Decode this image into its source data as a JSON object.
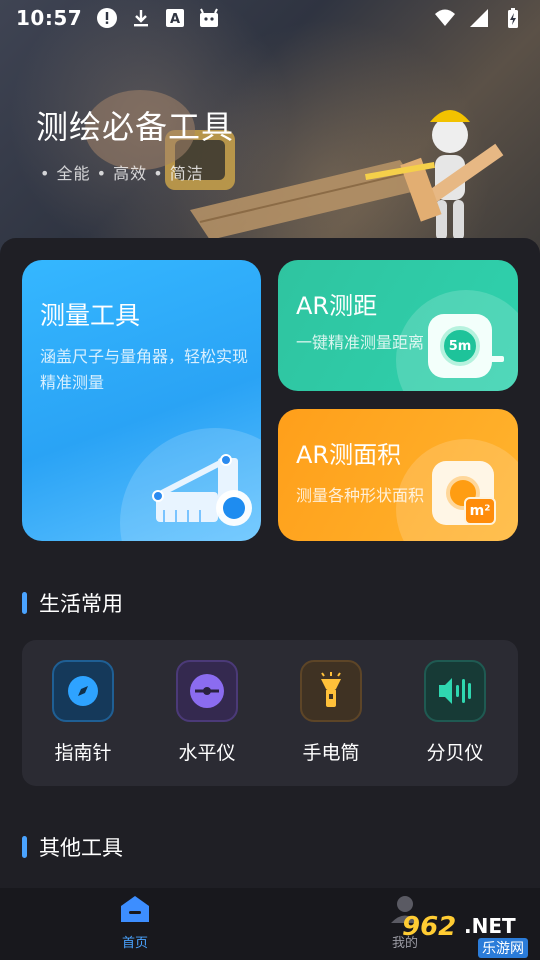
{
  "status_bar": {
    "time": "10:57"
  },
  "hero": {
    "title": "测绘必备工具",
    "subtitle": "• 全能  • 高效 •  简洁"
  },
  "cards": {
    "measure": {
      "title": "测量工具",
      "desc": "涵盖尺子与量角器，轻松实现精准测量"
    },
    "ar_distance": {
      "title": "AR测距",
      "desc": "一键精准测量距离",
      "badge": "5m"
    },
    "ar_area": {
      "title": "AR测面积",
      "desc": "测量各种形状面积",
      "badge": "m²"
    }
  },
  "sections": {
    "daily": "生活常用",
    "other": "其他工具"
  },
  "tools": [
    {
      "label": "指南针",
      "icon": "compass-icon"
    },
    {
      "label": "水平仪",
      "icon": "level-icon"
    },
    {
      "label": "手电筒",
      "icon": "flashlight-icon"
    },
    {
      "label": "分贝仪",
      "icon": "decibel-icon"
    }
  ],
  "nav": {
    "home": "首页",
    "me": "我的"
  },
  "watermark": {
    "num": "962",
    "net": ".NET",
    "site": "乐游网"
  },
  "colors": {
    "accent": "#4aa3ff",
    "measure_card": "#35b7ff",
    "ar_distance_card": "#2fc4a0",
    "ar_area_card": "#ffa51f"
  }
}
